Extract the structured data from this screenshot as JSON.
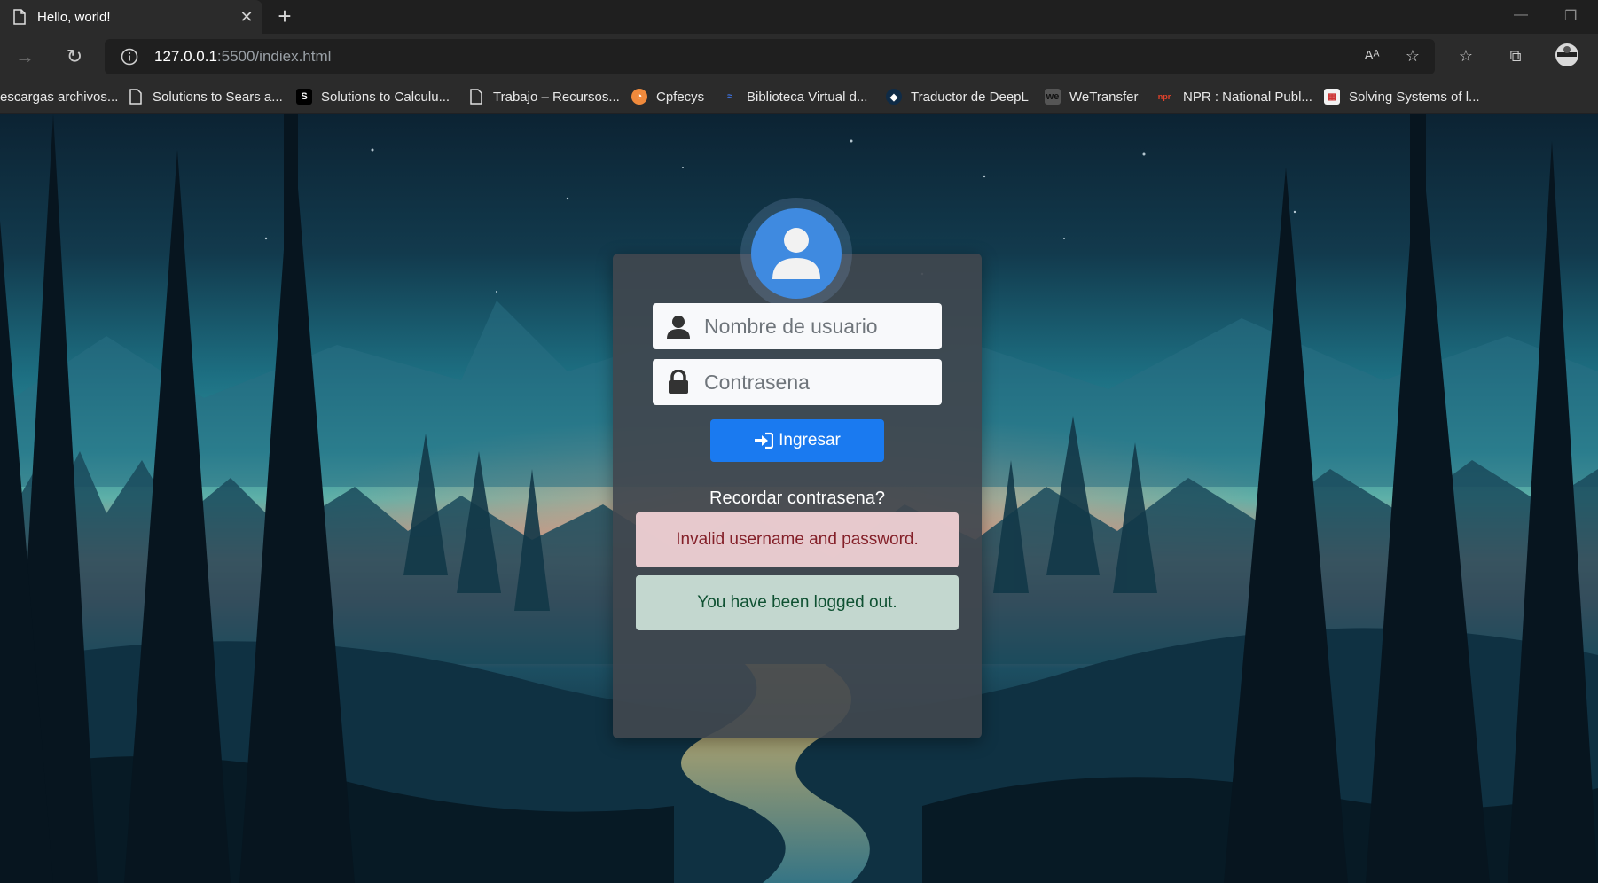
{
  "browser": {
    "tab_title": "Hello, world!",
    "url_host": "127.0.0.1",
    "url_path": ":5500/indiex.html",
    "bookmarks": [
      {
        "label": "escargas archivos...",
        "icon": "file-icon"
      },
      {
        "label": "Solutions to Sears a...",
        "icon": "file-icon"
      },
      {
        "label": "Solutions to Calculu...",
        "icon": "s-logo-icon"
      },
      {
        "label": "Trabajo – Recursos...",
        "icon": "file-icon"
      },
      {
        "label": "Cpfecys",
        "icon": "cpfecys-logo-icon"
      },
      {
        "label": "Biblioteca Virtual d...",
        "icon": "biblioteca-logo-icon"
      },
      {
        "label": "Traductor de DeepL",
        "icon": "deepl-logo-icon"
      },
      {
        "label": "WeTransfer",
        "icon": "wetransfer-logo-icon"
      },
      {
        "label": "NPR : National Publ...",
        "icon": "npr-logo-icon"
      },
      {
        "label": "Solving Systems of l...",
        "icon": "solving-logo-icon"
      }
    ]
  },
  "login": {
    "username_placeholder": "Nombre de usuario",
    "password_placeholder": "Contrasena",
    "submit_label": "Ingresar",
    "forgot_label": "Recordar contrasena?",
    "error_message": "Invalid username and password.",
    "logout_message": "You have been logged out."
  },
  "colors": {
    "primary": "#1a7af0",
    "avatar": "#3f8ae0",
    "alert_danger_bg": "#f8d7da",
    "alert_success_bg": "#d1e7dd"
  }
}
